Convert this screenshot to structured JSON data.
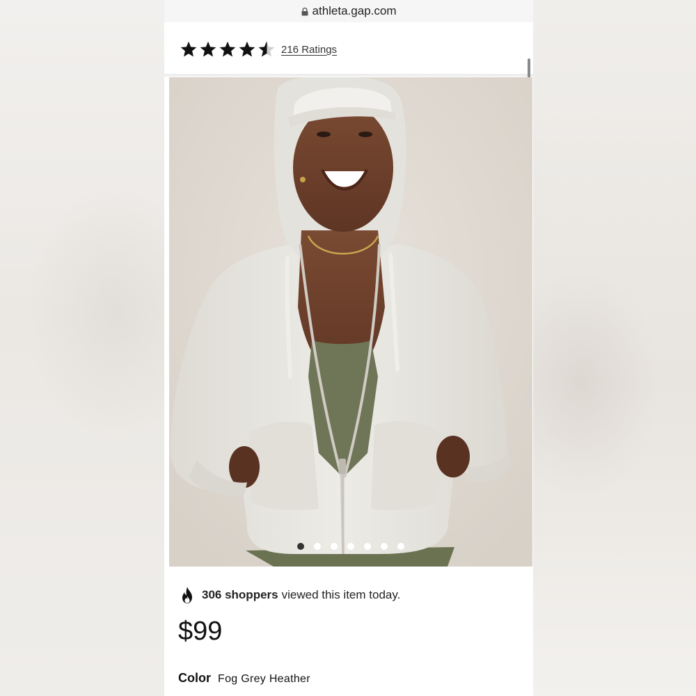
{
  "browser": {
    "url": "athleta.gap.com"
  },
  "ratings": {
    "stars": 4.5,
    "label": "216 Ratings"
  },
  "carousel": {
    "total_slides": 7,
    "active_index": 0
  },
  "views": {
    "count_text": "306 shoppers",
    "suffix_text": "viewed this item today."
  },
  "product": {
    "price": "$99",
    "color_label": "Color",
    "color_value": "Fog Grey Heather"
  },
  "colors": {
    "text_primary": "#111111",
    "star": "#111111",
    "active_dot": "#333333",
    "hoodie": "#e9e7e1",
    "tank": "#6f7557"
  }
}
